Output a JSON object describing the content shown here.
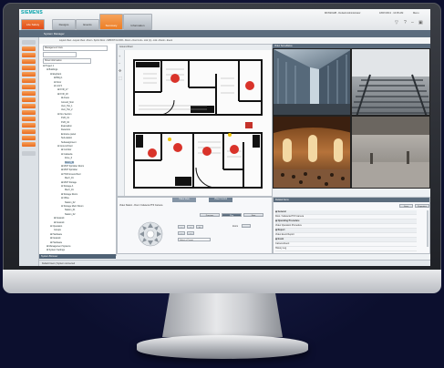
{
  "header": {
    "brand": "SIEMENS",
    "tabs": [
      {
        "label": "Life Safety",
        "style": "red"
      },
      {
        "label": "Designs",
        "style": "grey"
      },
      {
        "label": "Events",
        "style": "grey"
      },
      {
        "label": "Summary",
        "style": "orange"
      },
      {
        "label": "Information",
        "style": "grey"
      }
    ],
    "user": "MKS9012B - Default Administrator",
    "datetime": "18/07/2013 · 10:05 AM",
    "menu": "Menu"
  },
  "subbar": {
    "title": "System Manager"
  },
  "toolbar": {
    "breadcrumb": "Layout View  ›  Layout View  ›  Floor  ›  Sprint Floor  ›  SPRINT FLOOR  ›  Room  ›  Door Link  ›  Link (1)  ›  Link  ›  Room  ›  Event"
  },
  "tree": {
    "view_label": "Management View",
    "search_label": "Show Information",
    "search_placeholder": "Search",
    "nodes": [
      {
        "text": "⊟ Project 1",
        "level": 0
      },
      {
        "text": "⊟ Buildings",
        "level": 1
      },
      {
        "text": "⊟ Elephant",
        "level": 2
      },
      {
        "text": "⊞ Bldg 1",
        "level": 3
      },
      {
        "text": "⊟ Floor",
        "level": 3
      },
      {
        "text": "⊟ Unit 5",
        "level": 3
      },
      {
        "text": "⊞ KVR_17",
        "level": 4
      },
      {
        "text": "⊞ KVR_18",
        "level": 4
      },
      {
        "text": "⊞ Areas",
        "level": 5
      },
      {
        "text": "Ground_floor",
        "level": 5
      },
      {
        "text": "Vent_Hut_1",
        "level": 5
      },
      {
        "text": "Vent_Hut_2",
        "level": 5
      },
      {
        "text": "⊟ Fire Section",
        "level": 4
      },
      {
        "text": "KVR_01",
        "level": 5
      },
      {
        "text": "KVR_02",
        "level": 5
      },
      {
        "text": "Evacuation",
        "level": 5
      },
      {
        "text": "Detectors",
        "level": 5
      },
      {
        "text": "Entrance panel",
        "level": 5
      },
      {
        "text": "Sub-station",
        "level": 5
      },
      {
        "text": "Subassignment",
        "level": 5
      },
      {
        "text": "⊟ Ground Floor",
        "level": 4
      },
      {
        "text": "⊞ Corridor",
        "level": 5
      },
      {
        "text": "⊟ Cafeteria",
        "level": 5
      },
      {
        "text": "Zone_0",
        "level": 6
      },
      {
        "text": "Room_01",
        "level": 6,
        "selected": true
      },
      {
        "text": "⊞ MCP Sprinkler Room",
        "level": 5
      },
      {
        "text": "⊞ MCP Sprinkler",
        "level": 5
      },
      {
        "text": "⊟ HVR Ground floor",
        "level": 5
      },
      {
        "text": "Mezz_01",
        "level": 6
      },
      {
        "text": "⊞ MCP Storage",
        "level": 5
      },
      {
        "text": "⊟ Storage A",
        "level": 5
      },
      {
        "text": "Mezz_01",
        "level": 6
      },
      {
        "text": "⊞ Storage Room",
        "level": 5
      },
      {
        "text": "⊟ Office",
        "level": 5
      },
      {
        "text": "Station_02",
        "level": 6
      },
      {
        "text": "⊟ Storage Mezz Room",
        "level": 5
      },
      {
        "text": "Station_01",
        "level": 6
      },
      {
        "text": "Station_02",
        "level": 6
      },
      {
        "text": "⊞ Network",
        "level": 3
      },
      {
        "text": "⊞ Network",
        "level": 3
      },
      {
        "text": "⊟ Operation",
        "level": 2
      },
      {
        "text": "Groups",
        "level": 3
      },
      {
        "text": "⊞ Hardware",
        "level": 2
      },
      {
        "text": "⊞ Network",
        "level": 2
      },
      {
        "text": "⊞ Hardware",
        "level": 2
      },
      {
        "text": "⊞ Management Systems",
        "level": 1
      },
      {
        "text": "⊞ System Settings",
        "level": 1
      }
    ],
    "footer": "System Browser"
  },
  "floorplan": {
    "title": "Ground Floor",
    "alarms": [
      {
        "label": "alarm-1"
      },
      {
        "label": "alarm-2"
      },
      {
        "label": "alarm-3"
      },
      {
        "label": "alarm-4"
      },
      {
        "label": "alarm-5"
      },
      {
        "label": "alarm-6"
      },
      {
        "label": "alarm-7"
      }
    ]
  },
  "video": {
    "title": "Video Surveillance"
  },
  "ptz_panel": {
    "tabs": [
      "Video View",
      "Video Control"
    ],
    "title": "Video Station - Root / Cafeteria PTZ Camera",
    "buttons": [
      "Previous",
      "Play",
      "Next"
    ],
    "zoom_label": "Zoom",
    "preset_label": "Select a Preset"
  },
  "props_panel": {
    "header": "Related Items",
    "buttons": [
      "Save",
      "Properties"
    ],
    "rows": [
      {
        "text": "⊟ General",
        "group": true
      },
      {
        "text": "Root / Cafeteria PTZ Camera",
        "group": false
      },
      {
        "text": "⊟ Operating Procedure",
        "group": true
      },
      {
        "text": "Video Operation Procedure",
        "group": false
      },
      {
        "text": "⊟ Report",
        "group": true
      },
      {
        "text": "Video Event Report",
        "group": false
      },
      {
        "text": "⊟ Event",
        "group": true
      },
      {
        "text": "Camera Event",
        "group": false
      },
      {
        "text": "History Log",
        "group": false
      }
    ]
  },
  "status_bar": {
    "text": "Default Users  |  System connected"
  },
  "colors": {
    "accent": "#e96a1f",
    "brand": "#00a0a8",
    "alarm": "#d9332a",
    "header_bar": "#5b6c7d"
  }
}
